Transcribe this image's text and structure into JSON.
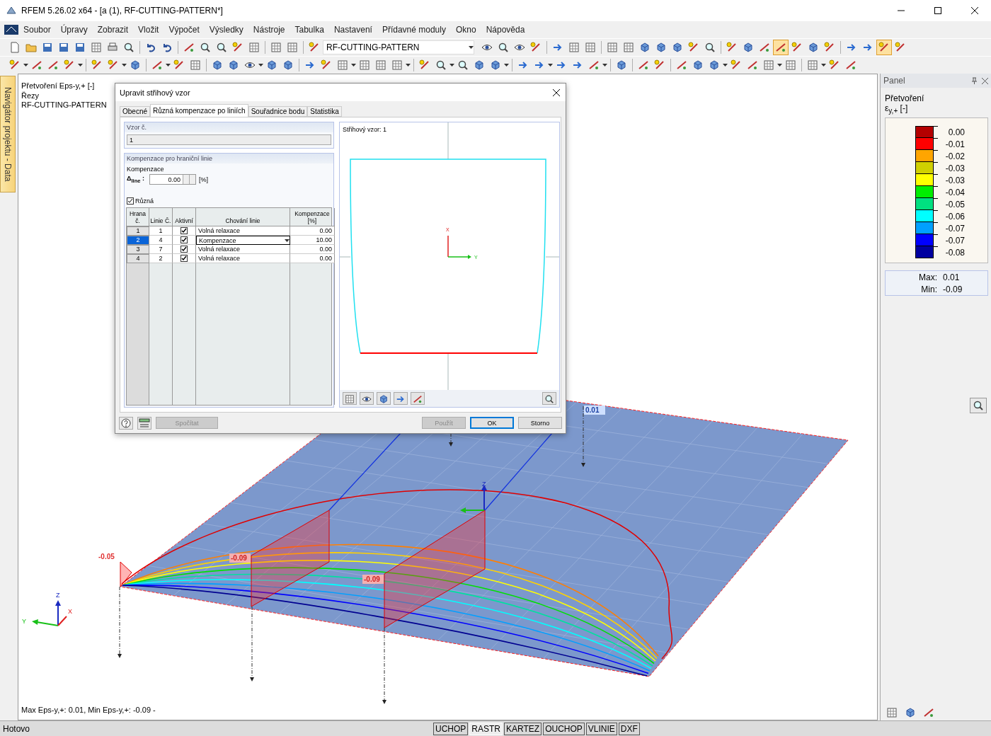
{
  "window": {
    "title": "RFEM 5.26.02 x64 - [a (1), RF-CUTTING-PATTERN*]"
  },
  "menu": [
    "Soubor",
    "Úpravy",
    "Zobrazit",
    "Vložit",
    "Výpočet",
    "Výsledky",
    "Nástroje",
    "Tabulka",
    "Nastavení",
    "Přídavné moduly",
    "Okno",
    "Nápověda"
  ],
  "toolbar": {
    "module_select": "RF-CUTTING-PATTERN"
  },
  "navigator_tab": "Navigátor projektu - Data",
  "viewport": {
    "info_lines": [
      "Přetvoření Eps-y,+ [-]",
      "Řezy",
      "RF-CUTTING-PATTERN"
    ],
    "value_labels": [
      "-0.05",
      "-0.09",
      "-0.09",
      "0.01"
    ],
    "plate_axis": "Z",
    "axes": {
      "z": "Z",
      "y": "Y",
      "x": "X"
    },
    "summary": "Max Eps-y,+: 0.01, Min Eps-y,+: -0.09 -"
  },
  "dialog": {
    "title": "Upravit střihový vzor",
    "tabs": [
      {
        "label": "Obecné",
        "selected": false
      },
      {
        "label": "Různá kompenzace po liniích",
        "selected": true
      },
      {
        "label": "Souřadnice bodu",
        "selected": false
      },
      {
        "label": "Statistika",
        "selected": false
      }
    ],
    "pattern_group": {
      "title": "Vzor č.",
      "value": "1"
    },
    "compensation_group": {
      "title": "Kompenzace pro hraniční linie",
      "label": "Kompenzace",
      "delta_label": "Δ$_{line}$ :",
      "value": "0.00",
      "unit": "[%]",
      "different": {
        "label": "Různá",
        "checked": true
      },
      "table": {
        "columns": [
          "Hrana č.",
          "Linie Č.",
          "Aktivní",
          "Chování linie",
          "Kompenzace [%]"
        ],
        "rows": [
          {
            "edge": "1",
            "line": "1",
            "active": true,
            "behavior": "Volná relaxace",
            "compensation": "0.00",
            "selected": false,
            "editing": false
          },
          {
            "edge": "2",
            "line": "4",
            "active": true,
            "behavior": "Kompenzace",
            "compensation": "10.00",
            "selected": true,
            "editing": true
          },
          {
            "edge": "3",
            "line": "7",
            "active": true,
            "behavior": "Volná relaxace",
            "compensation": "0.00",
            "selected": false,
            "editing": false
          },
          {
            "edge": "4",
            "line": "2",
            "active": true,
            "behavior": "Volná relaxace",
            "compensation": "0.00",
            "selected": false,
            "editing": false
          }
        ]
      }
    },
    "preview": {
      "title": "Střihový vzor: 1",
      "axis_x": "X",
      "axis_y": "Y"
    },
    "left_buttons": [
      {
        "label": "Spočítat",
        "disabled": true,
        "default": false
      }
    ],
    "right_buttons": [
      {
        "label": "Použít",
        "disabled": true,
        "default": false
      },
      {
        "label": "OK",
        "disabled": false,
        "default": true
      },
      {
        "label": "Storno",
        "disabled": false,
        "default": false
      }
    ]
  },
  "panel": {
    "title": "Panel",
    "heading": "Přetvoření",
    "quantity": "ε$_{y,+}$ [-]",
    "legend": [
      {
        "color": "#b40000",
        "value": "0.00"
      },
      {
        "color": "#ff0000",
        "value": "-0.01"
      },
      {
        "color": "#ffa500",
        "value": "-0.02"
      },
      {
        "color": "#d0d000",
        "value": "-0.03"
      },
      {
        "color": "#ffff00",
        "value": "-0.03"
      },
      {
        "color": "#00ee00",
        "value": "-0.04"
      },
      {
        "color": "#00e080",
        "value": "-0.05"
      },
      {
        "color": "#00ffff",
        "value": "-0.06"
      },
      {
        "color": "#00a0ff",
        "value": "-0.07"
      },
      {
        "color": "#0000ff",
        "value": "-0.07"
      },
      {
        "color": "#0000a0",
        "value": "-0.08"
      }
    ],
    "max_label": "Max:",
    "max": "0.01",
    "min_label": "Min:",
    "min": "-0.09"
  },
  "status_bar": {
    "text": "Hotovo",
    "toggles": [
      {
        "label": "UCHOP",
        "selected": false
      },
      {
        "label": "RASTR",
        "selected": true
      },
      {
        "label": "KARTEZ",
        "selected": false
      },
      {
        "label": "OUCHOP",
        "selected": false
      },
      {
        "label": "VLINIE",
        "selected": false
      },
      {
        "label": "DXF",
        "selected": false
      }
    ]
  }
}
